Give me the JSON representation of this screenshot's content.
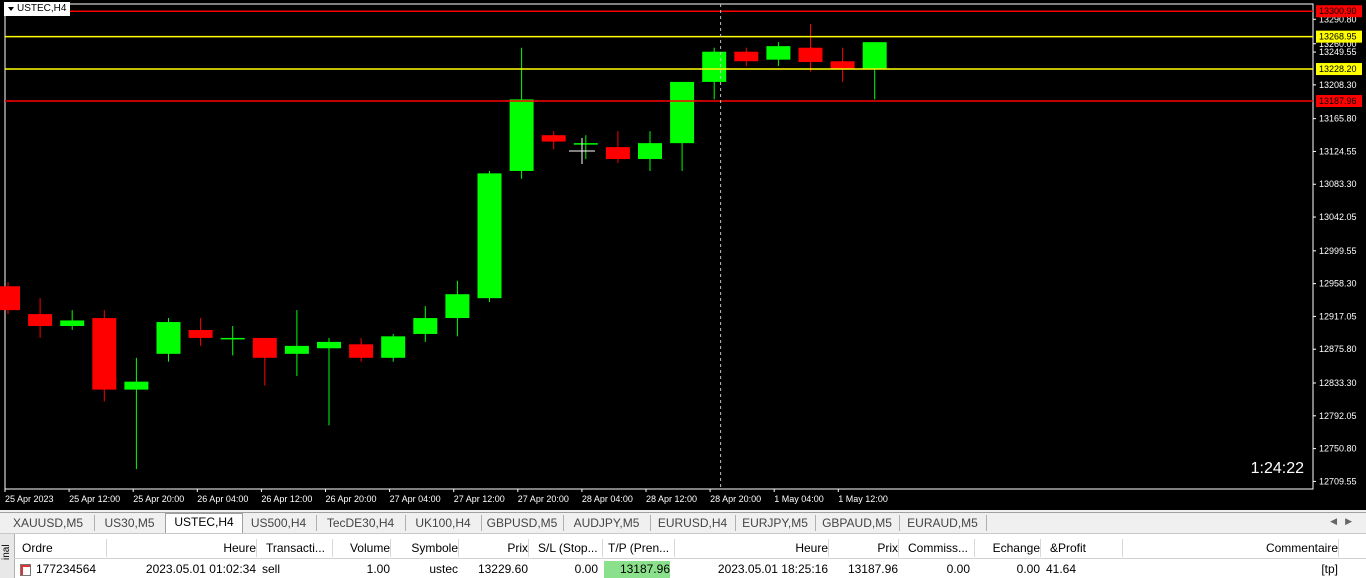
{
  "chart": {
    "symbol_label": "USTEC,H4",
    "timer": "1:24:22"
  },
  "colors": {
    "background": "#000000",
    "bull": "#00ff00",
    "bear": "#ff0000",
    "wick_bull": "#00ff00",
    "wick_bear": "#ff0000",
    "red_level": "#ff0000",
    "yellow_level": "#ffff00",
    "axis_text": "#ffffff",
    "crosshair": "#c0c0c0"
  },
  "chart_data": {
    "type": "candlestick",
    "title": "USTEC,H4",
    "ylim": [
      12700,
      13310
    ],
    "y_ticks": [
      "13290.80",
      "13260.00",
      "13249.55",
      "13208.30",
      "13165.80",
      "13124.55",
      "13083.30",
      "13042.05",
      "12999.55",
      "12958.30",
      "12917.05",
      "12875.80",
      "12833.30",
      "12792.05",
      "12750.80",
      "12709.55"
    ],
    "x_ticks": [
      "25 Apr 2023",
      "25 Apr 12:00",
      "25 Apr 20:00",
      "26 Apr 04:00",
      "26 Apr 12:00",
      "26 Apr 20:00",
      "27 Apr 04:00",
      "27 Apr 12:00",
      "27 Apr 20:00",
      "28 Apr 04:00",
      "28 Apr 12:00",
      "28 Apr 20:00",
      "1 May 04:00",
      "1 May 12:00"
    ],
    "candles": [
      {
        "o": 12955,
        "h": 12960,
        "l": 12920,
        "c": 12925
      },
      {
        "o": 12920,
        "h": 12940,
        "l": 12890,
        "c": 12905
      },
      {
        "o": 12905,
        "h": 12925,
        "l": 12900,
        "c": 12912
      },
      {
        "o": 12915,
        "h": 12925,
        "l": 12810,
        "c": 12825
      },
      {
        "o": 12825,
        "h": 12865,
        "l": 12725,
        "c": 12835
      },
      {
        "o": 12870,
        "h": 12915,
        "l": 12860,
        "c": 12910
      },
      {
        "o": 12900,
        "h": 12915,
        "l": 12880,
        "c": 12890
      },
      {
        "o": 12890,
        "h": 12905,
        "l": 12868,
        "c": 12890
      },
      {
        "o": 12890,
        "h": 12890,
        "l": 12830,
        "c": 12865
      },
      {
        "o": 12870,
        "h": 12925,
        "l": 12842,
        "c": 12880
      },
      {
        "o": 12877,
        "h": 12890,
        "l": 12780,
        "c": 12885
      },
      {
        "o": 12882,
        "h": 12890,
        "l": 12860,
        "c": 12865
      },
      {
        "o": 12865,
        "h": 12895,
        "l": 12860,
        "c": 12892
      },
      {
        "o": 12895,
        "h": 12930,
        "l": 12885,
        "c": 12915
      },
      {
        "o": 12915,
        "h": 12962,
        "l": 12892,
        "c": 12945
      },
      {
        "o": 12940,
        "h": 13100,
        "l": 12935,
        "c": 13097
      },
      {
        "o": 13100,
        "h": 13255,
        "l": 13090,
        "c": 13190
      },
      {
        "o": 13145,
        "h": 13150,
        "l": 13127,
        "c": 13137
      },
      {
        "o": 13135,
        "h": 13145,
        "l": 13115,
        "c": 13135
      },
      {
        "o": 13130,
        "h": 13150,
        "l": 13110,
        "c": 13115
      },
      {
        "o": 13115,
        "h": 13150,
        "l": 13100,
        "c": 13135
      },
      {
        "o": 13135,
        "h": 13205,
        "l": 13100,
        "c": 13212
      },
      {
        "o": 13212,
        "h": 13255,
        "l": 13190,
        "c": 13250
      },
      {
        "o": 13250,
        "h": 13255,
        "l": 13232,
        "c": 13238
      },
      {
        "o": 13240,
        "h": 13262,
        "l": 13232,
        "c": 13257
      },
      {
        "o": 13255,
        "h": 13285,
        "l": 13225,
        "c": 13237
      },
      {
        "o": 13238,
        "h": 13255,
        "l": 13212,
        "c": 13228
      },
      {
        "o": 13229,
        "h": 13262,
        "l": 13190,
        "c": 13262
      }
    ],
    "levels": [
      {
        "value": 13300.9,
        "label": "13300.90",
        "color": "red"
      },
      {
        "value": 13268.95,
        "label": "13268.95",
        "color": "yellow"
      },
      {
        "value": 13228.2,
        "label": "13228.20",
        "color": "yellow"
      },
      {
        "value": 13187.96,
        "label": "13187.96",
        "color": "red"
      }
    ],
    "crosshair_candle_index": 22.2
  },
  "tabs": [
    {
      "label": "XAUUSD,M5",
      "active": false
    },
    {
      "label": "US30,M5",
      "active": false
    },
    {
      "label": "USTEC,H4",
      "active": true
    },
    {
      "label": "US500,H4",
      "active": false
    },
    {
      "label": "TecDE30,H4",
      "active": false
    },
    {
      "label": "UK100,H4",
      "active": false
    },
    {
      "label": "GBPUSD,M5",
      "active": false
    },
    {
      "label": "AUDJPY,M5",
      "active": false
    },
    {
      "label": "EURUSD,H4",
      "active": false
    },
    {
      "label": "EURJPY,M5",
      "active": false
    },
    {
      "label": "GBPAUD,M5",
      "active": false
    },
    {
      "label": "EURAUD,M5",
      "active": false
    }
  ],
  "terminal": {
    "side_label": "inal",
    "headers": [
      "Ordre",
      "Heure",
      "Transacti...",
      "Volume",
      "Symbole",
      "Prix",
      "S/L (Stop...",
      "T/P (Pren...",
      "Heure",
      "Prix",
      "Commiss...",
      "Echange",
      "&Profit",
      "Commentaire"
    ],
    "row": [
      "177234564",
      "2023.05.01 01:02:34",
      "sell",
      "1.00",
      "ustec",
      "13229.60",
      "0.00",
      "13187.96",
      "2023.05.01 18:25:16",
      "13187.96",
      "0.00",
      "0.00",
      "41.64",
      "[tp]"
    ],
    "icon": "order-icon"
  }
}
